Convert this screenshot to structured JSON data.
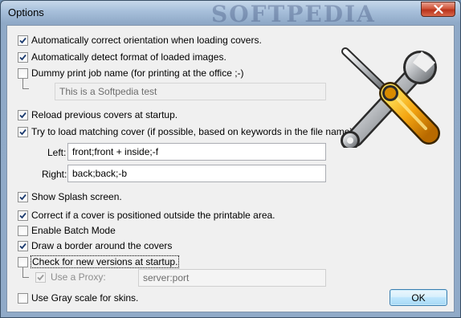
{
  "window": {
    "title": "Options",
    "watermark": "SOFTPEDIA"
  },
  "options": {
    "auto_orientation": {
      "label": "Automatically correct orientation when loading  covers.",
      "checked": true
    },
    "auto_detect_format": {
      "label": "Automatically detect format of loaded images.",
      "checked": true
    },
    "dummy_print_job": {
      "label": "Dummy print job name (for printing at the office ;-)",
      "checked": false
    },
    "dummy_job_name_value": "This is a Softpedia test",
    "reload_previous": {
      "label": "Reload previous covers at startup.",
      "checked": true
    },
    "try_load_matching": {
      "label": "Try to load matching cover (if possible, based on keywords in the file name).",
      "checked": true
    },
    "left_label": "Left:",
    "left_value": "front;front + inside;-f",
    "right_label": "Right:",
    "right_value": "back;back;-b",
    "show_splash": {
      "label": "Show Splash screen.",
      "checked": true
    },
    "correct_outside": {
      "label": "Correct if a cover is positioned outside the printable area.",
      "checked": true
    },
    "batch_mode": {
      "label": "Enable Batch Mode",
      "checked": false
    },
    "draw_border": {
      "label": "Draw a border around the covers",
      "checked": true
    },
    "check_versions": {
      "label": "Check for new versions at startup.",
      "checked": false
    },
    "use_proxy": {
      "label": "Use a Proxy:",
      "checked": true,
      "disabled": true
    },
    "proxy_value": "server:port",
    "gray_scale": {
      "label": "Use Gray scale for skins.",
      "checked": false
    }
  },
  "buttons": {
    "ok": "OK"
  },
  "icons": {
    "close": "close-icon",
    "check": "check-icon",
    "tools": "wrench-screwdriver-icon"
  }
}
